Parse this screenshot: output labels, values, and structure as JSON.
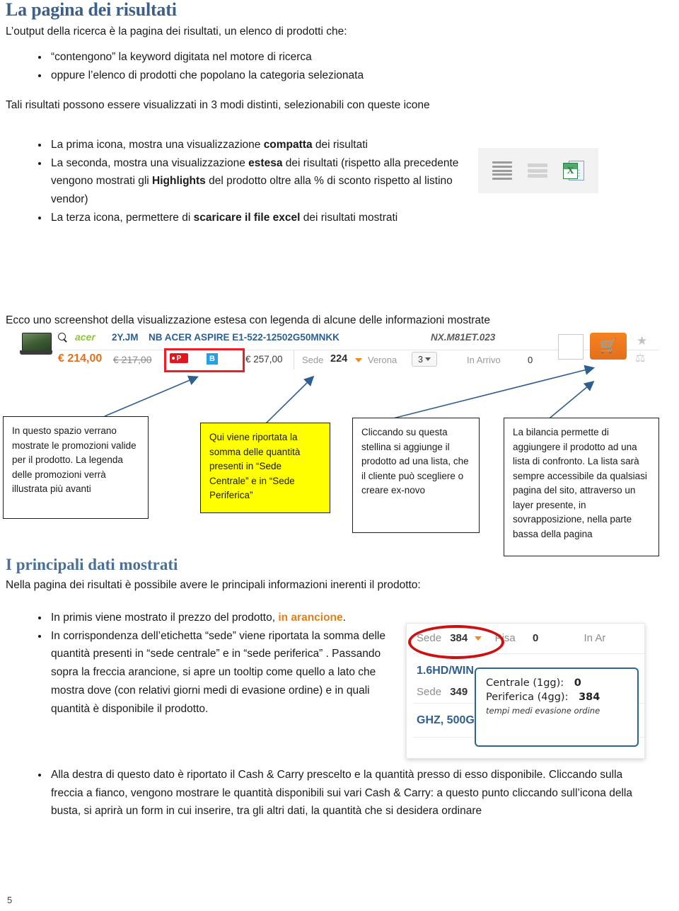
{
  "page": {
    "number": "5"
  },
  "section1": {
    "heading": "La pagina dei risultati",
    "intro": "L’output della ricerca è la pagina dei risultati, un elenco di prodotti che:",
    "bullets": [
      "“contengono” la keyword digitata nel motore di ricerca",
      "oppure l’elenco di prodotti che popolano la categoria selezionata"
    ],
    "paragraph2": "Tali risultati possono essere visualizzati in 3 modi distinti, selezionabili con queste icone",
    "bullets2": {
      "item1_pre": "La prima icona, mostra una visualizzazione ",
      "item1_bold": "compatta",
      "item1_post": " dei risultati",
      "item2_pre": "La seconda, mostra una visualizzazione ",
      "item2_bold": "estesa",
      "item2_mid": " dei risultati (rispetto alla precedente vengono mostrati gli ",
      "item2_bold2": "Highlights",
      "item2_post": " del prodotto oltre alla % di sconto rispetto al listino vendor)",
      "item3_pre": "La terza icona, permettere di ",
      "item3_bold": "scaricare il file excel",
      "item3_post": " dei risultati mostrati"
    }
  },
  "view_icons": {
    "compact_name": "compact-view-icon",
    "extended_name": "extended-view-icon",
    "excel_name": "excel-export-icon",
    "excel_letter": "X"
  },
  "screenshot_caption": "Ecco uno screenshot della visualizzazione estesa con legenda di alcune delle informazioni mostrate",
  "product_row": {
    "brand": "acer",
    "code": "2Y.JM",
    "name": "NB ACER ASPIRE E1-522-12502G50MNKK",
    "sku": "NX.M81ET.023",
    "price": "€ 214,00",
    "price_old": "€ 217,00",
    "promo_p": "P",
    "promo_b": "B",
    "price_listino": "€ 257,00",
    "sede_label": "Sede",
    "sede_value": "224",
    "city_label": "Verona",
    "qty_value": "3",
    "inarrivo_label": "In Arrivo",
    "inarrivo_value": "0",
    "cart_glyph": "🛒",
    "star_glyph": "★",
    "scale_glyph": "⚖"
  },
  "callouts": [
    {
      "id": "promo-callout",
      "text": "In questo spazio verrano mostrate le promozioni valide per il prodotto. La legenda delle promozioni verrà illustrata più avanti"
    },
    {
      "id": "quantity-callout",
      "text": "Qui viene riportata la somma delle quantità presenti in “Sede Centrale” e in “Sede Periferica”"
    },
    {
      "id": "star-callout",
      "text": "Cliccando su questa stellina si aggiunge il prodotto ad una lista, che il cliente può scegliere o creare ex-novo"
    },
    {
      "id": "scale-callout",
      "text": "La bilancia permette di aggiungere il prodotto ad una lista di confronto. La lista sarà sempre accessibile da qualsiasi pagina del sito, attraverso un layer presente, in sovrapposizione, nella parte bassa della pagina"
    }
  ],
  "section2": {
    "heading": "I principali dati mostrati",
    "intro": "Nella pagina dei risultati è possibile avere le principali informazioni inerenti il prodotto:",
    "bullet1_pre": "In primis viene mostrato il prezzo del prodotto, ",
    "bullet1_orange": "in arancione",
    "bullet1_post": ".",
    "bullet2": "In corrispondenza dell’etichetta “sede” viene riportata la somma delle quantità presenti in “sede centrale”  e in “sede periferica” . Passando sopra la freccia arancione, si apre un tooltip come quello a lato  che mostra dove (con relativi giorni medi di evasione ordine) e in quali quantità è disponibile il prodotto.",
    "bullet3": "Alla destra  di questo dato è riportato il Cash & Carry prescelto e la quantità presso di esso disponibile. Cliccando sulla freccia a fianco, vengono mostrare le quantità disponibili sui vari Cash & Carry: a questo punto cliccando sull’icona della busta, si aprirà un form in cui inserire, tra gli altri dati, la quantità che si desidera ordinare"
  },
  "tooltip_shot": {
    "sede_label": "Sede",
    "sede_value": "384",
    "city_label": "Pisa",
    "city_value": "0",
    "inarrivo_partial": "In Ar",
    "product_line": "1.6HD/WIN",
    "sede_label2": "Sede",
    "sede_value2": "349",
    "product_line2": "GHZ, 500G",
    "popup": {
      "line1_label": "Centrale (1gg):",
      "line1_value": "0",
      "line2_label": "Periferica (4gg):",
      "line2_value": "384",
      "footer": "tempi medi evasione ordine"
    }
  },
  "colors": {
    "heading": "#3d6089",
    "orange": "#e0811e",
    "price_orange": "#e2701c",
    "yellow_callout": "#ffff00",
    "arrow_blue": "#2f5f8f",
    "red_highlight": "#ee1c25"
  }
}
